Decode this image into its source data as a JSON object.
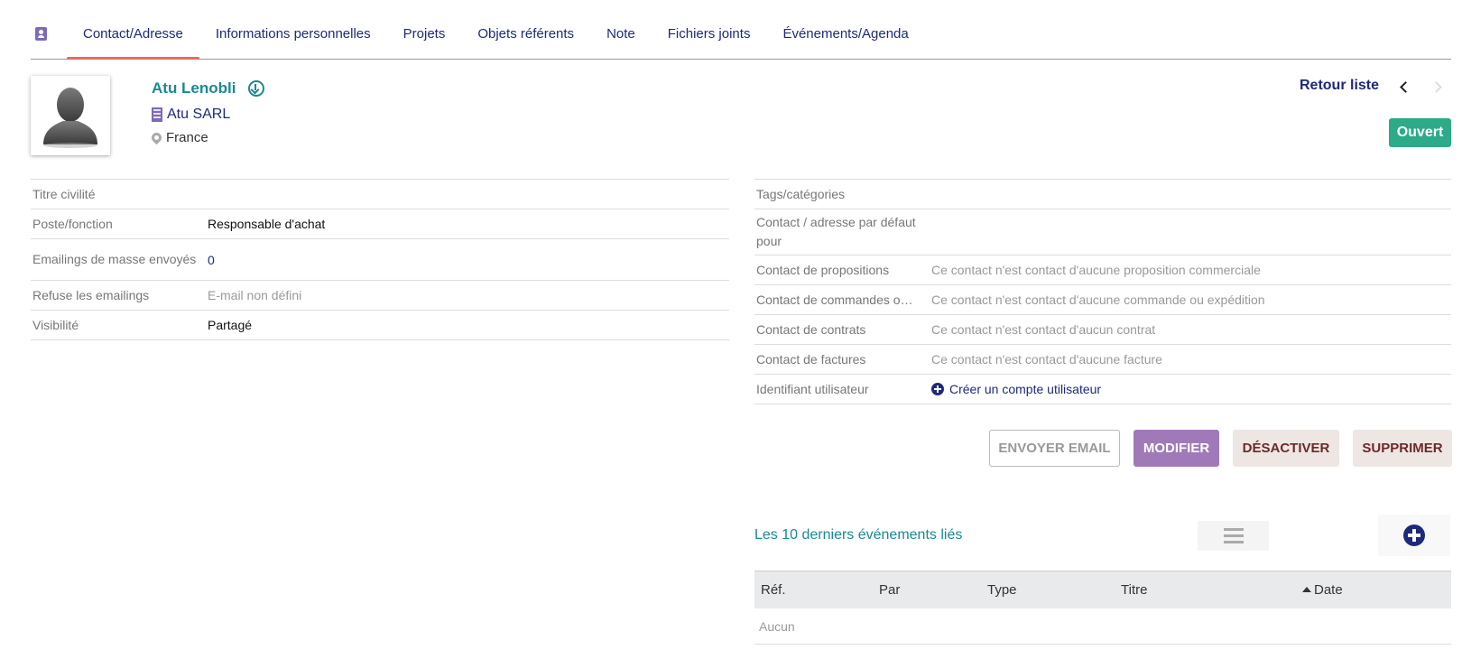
{
  "tabs": [
    {
      "label": "Contact/Adresse",
      "active": true
    },
    {
      "label": "Informations personnelles"
    },
    {
      "label": "Projets"
    },
    {
      "label": "Objets référents"
    },
    {
      "label": "Note"
    },
    {
      "label": "Fichiers joints"
    },
    {
      "label": "Événements/Agenda"
    }
  ],
  "header": {
    "name": "Atu Lenobli",
    "company": "Atu SARL",
    "country": "France",
    "back_list": "Retour liste",
    "status": "Ouvert"
  },
  "left_fields": [
    {
      "label": "Titre civilité",
      "value": ""
    },
    {
      "label": "Poste/fonction",
      "value": "Responsable d'achat"
    },
    {
      "label": "Emailings de masse envoyés",
      "value": "0"
    },
    {
      "label": "Refuse les emailings",
      "value": "E-mail non défini"
    },
    {
      "label": "Visibilité",
      "value": "Partagé"
    }
  ],
  "right_fields": [
    {
      "label": "Tags/catégories",
      "value": ""
    },
    {
      "label": "Contact / adresse par défaut pour",
      "value": ""
    },
    {
      "label": "Contact de propositions",
      "value": "Ce contact n'est contact d'aucune proposition commerciale"
    },
    {
      "label": "Contact de commandes o…",
      "value": "Ce contact n'est contact d'aucune commande ou expédition"
    },
    {
      "label": "Contact de contrats",
      "value": "Ce contact n'est contact d'aucun contrat"
    },
    {
      "label": "Contact de factures",
      "value": "Ce contact n'est contact d'aucune facture"
    },
    {
      "label": "Identifiant utilisateur",
      "value": "Créer un compte utilisateur"
    }
  ],
  "actions": {
    "send_email": "ENVOYER EMAIL",
    "modify": "MODIFIER",
    "disable": "DÉSACTIVER",
    "delete": "SUPPRIMER"
  },
  "events": {
    "title": "Les 10 derniers événements liés",
    "columns": [
      "Réf.",
      "Par",
      "Type",
      "Titre",
      "Date"
    ],
    "empty": "Aucun"
  },
  "colors": {
    "accent": "#1a8a8f",
    "nav": "#1e2a78",
    "status_open": "#2daa87",
    "modify": "#a07ab8",
    "tab_underline": "#e86a5f"
  }
}
